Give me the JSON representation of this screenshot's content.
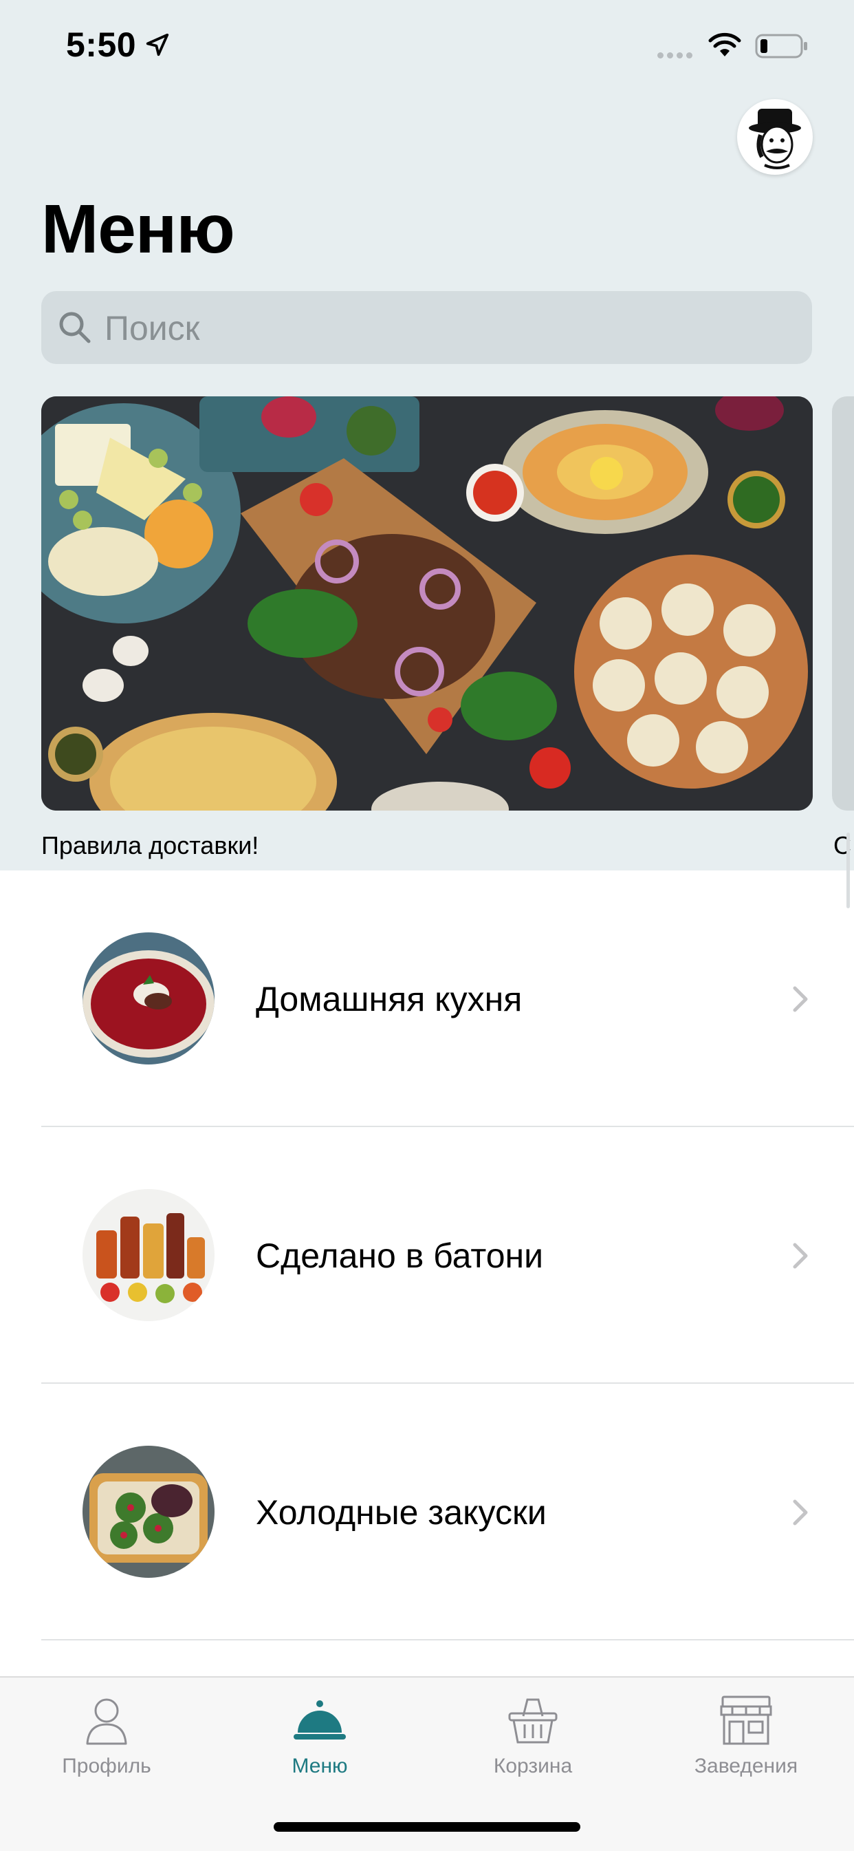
{
  "status_bar": {
    "time": "5:50"
  },
  "header": {
    "title": "Меню"
  },
  "search": {
    "placeholder": "Поиск"
  },
  "banners": [
    {
      "caption": "Правила доставки!"
    },
    {
      "caption": "С"
    }
  ],
  "categories": [
    {
      "label": "Домашняя кухня"
    },
    {
      "label": "Сделано в батони"
    },
    {
      "label": "Холодные закуски"
    }
  ],
  "tabbar": {
    "tabs": [
      {
        "label": "Профиль",
        "icon": "profile-icon"
      },
      {
        "label": "Меню",
        "icon": "cloche-icon",
        "active": true
      },
      {
        "label": "Корзина",
        "icon": "basket-icon"
      },
      {
        "label": "Заведения",
        "icon": "storefront-icon"
      }
    ]
  },
  "colors": {
    "accent": "#1e7a82",
    "header_bg": "#e7eef0",
    "search_bg": "#d4dcdf",
    "inactive": "#8e8e93"
  }
}
